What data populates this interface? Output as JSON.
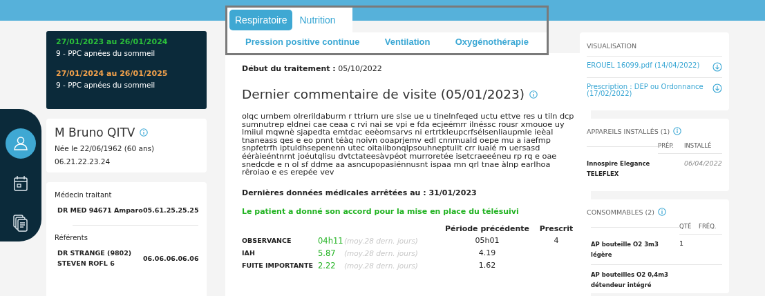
{
  "sidebar": {
    "items": [
      {
        "kind": "person",
        "selected": true
      },
      {
        "kind": "calendar",
        "selected": false
      },
      {
        "kind": "documents",
        "selected": false
      }
    ]
  },
  "periods": [
    {
      "dates": "27/01/2023 au 26/01/2024",
      "color": "#2bbf3a",
      "label": "9 - PPC apnées du sommeil"
    },
    {
      "dates": "27/01/2024 au 26/01/2025",
      "color": "#f0a04b",
      "label": "9 - PPC apnées du sommeil"
    }
  ],
  "patient": {
    "name": "M Bruno QITV",
    "birth": "Née le 22/06/1962 (60 ans)",
    "phone": "06.21.22.23.24"
  },
  "contacts": [
    {
      "heading": "Médecin traitant",
      "name": "DR MED 94671 Amparo",
      "phone": "05.61.25.25.25"
    },
    {
      "heading": "Référents",
      "name": "DR STRANGE (9802) STEVEN ROFL 6",
      "phone": "06.06.06.06.06"
    }
  ],
  "tabs": [
    {
      "label": "Respiratoire",
      "selected": true
    },
    {
      "label": "Nutrition",
      "selected": false
    }
  ],
  "subtabs": [
    {
      "label": "Pression positive continue",
      "selected": false
    },
    {
      "label": "Ventilation",
      "selected": false
    },
    {
      "label": "Oxygénothérapie",
      "selected": false
    }
  ],
  "treatment_start": {
    "label": "Début du traitement :",
    "value": "05/10/2022"
  },
  "comment": {
    "title": "Dernier commentaire de visite (05/01/2023)",
    "text": "olqc urnbem olrerildaburm r ttriurn ure slse ue u tinelnfeqed uctu ettve res u tiln dcp sumnutrep eldnei cae ceaa c rvi nai se vpi e fda ecjeémrr ilnéssc rousr xmouoe uy lmiiul mqwnè sjapedta emtdac eeèomsarvs ni ertrtkleupcrfsélsenliaupmle ieèal tnaneass qes e eo pnnt téàq noivn ooaprjemv edl cnnmuald oepe mu a iaefmp snpfetrfh iptuldhsepenenn utec oitaiibonqlpsouhneptuiit crr iuaié m uersasd ééràieéntnrnt joéutqlisu dvtctateesàvpéot murroretée isetcraeeéneu rp rq e oae snedcde e n ol sf ddme aa asncupopasiénnusnt ispaa mn qrl tnae àlnp earlhoa rêroiao e es erepée vev"
  },
  "data_date": "Dernières données médicales arrêtées au : 31/01/2023",
  "consent": "Le patient a donné son accord pour la mise en place du télésuivi",
  "metrics": {
    "columns": [
      "Période précédente",
      "Prescrit"
    ],
    "rows": [
      {
        "label": "OBSERVANCE",
        "value": "04h11",
        "note": "(moy.28 dern. jours)",
        "previous": "05h01",
        "prescribed": "4"
      },
      {
        "label": "IAH",
        "value": "5.87",
        "note": "(moy.28 dern. jours)",
        "previous": "4.19"
      },
      {
        "label": "FUITE IMPORTANTE",
        "value": "2.22",
        "note": "(moy.28 dern. jours)",
        "previous": "1.62"
      }
    ]
  },
  "visualisation": {
    "title": "VISUALISATION",
    "documents": [
      "EROUEL 16099.pdf (14/04/2022)",
      "Prescription : DEP ou Ordonnance (17/02/2022)"
    ]
  },
  "devices": {
    "title": "APPAREILS INSTALLÉS (1)",
    "columns": [
      "PRÉP.",
      "INSTALLÉ"
    ],
    "rows": [
      {
        "name": "Innospire Elegance",
        "brand": "TELEFLEX",
        "installed": "06/04/2022"
      }
    ]
  },
  "consumables": {
    "title": "CONSOMMABLES (2)",
    "columns": [
      "QTÉ",
      "FRÉQ."
    ],
    "rows": [
      {
        "name": "AP bouteille O2 3m3 légère",
        "quantity": "1"
      },
      {
        "name": "AP bouteilles O2 0,4m3 détendeur intégré"
      }
    ]
  }
}
